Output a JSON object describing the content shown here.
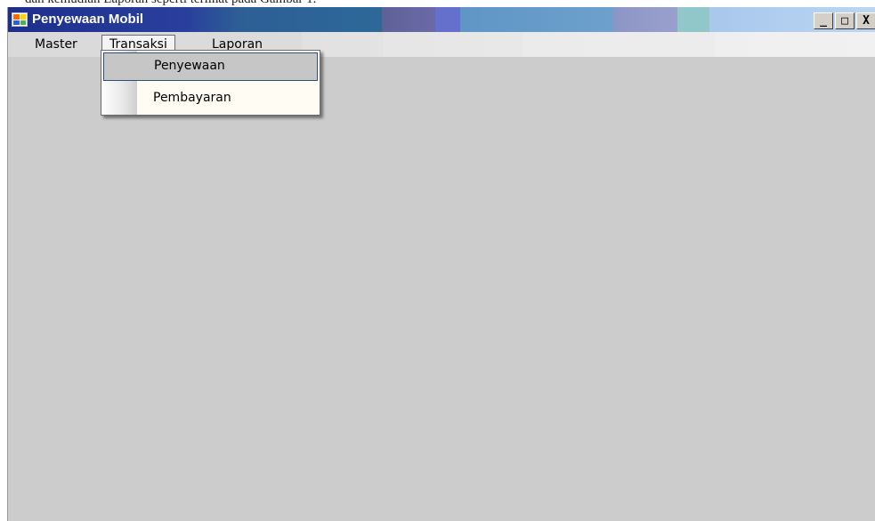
{
  "caption_fragment": "dan kemudian Laporan seperti terlihat pada Gambar 1.",
  "window": {
    "title": "Penyewaan Mobil",
    "controls": {
      "minimize": "_",
      "maximize": "□",
      "close": "X"
    }
  },
  "menubar": {
    "items": [
      {
        "label": "Master"
      },
      {
        "label": "Transaksi",
        "open": true
      },
      {
        "label": "Laporan"
      }
    ]
  },
  "dropdown": {
    "parent": "Transaksi",
    "items": [
      {
        "label": "Penyewaan",
        "highlighted": true
      },
      {
        "label": "Pembayaran"
      }
    ]
  },
  "colors": {
    "titlebar_start": "#1d2e8c",
    "client_area": "#cccccc",
    "menu_popup": "#fffdf3",
    "highlight": "#c6c6c6",
    "highlight_border": "#2f4f7a"
  },
  "icons": {
    "app": "application-form-icon"
  }
}
